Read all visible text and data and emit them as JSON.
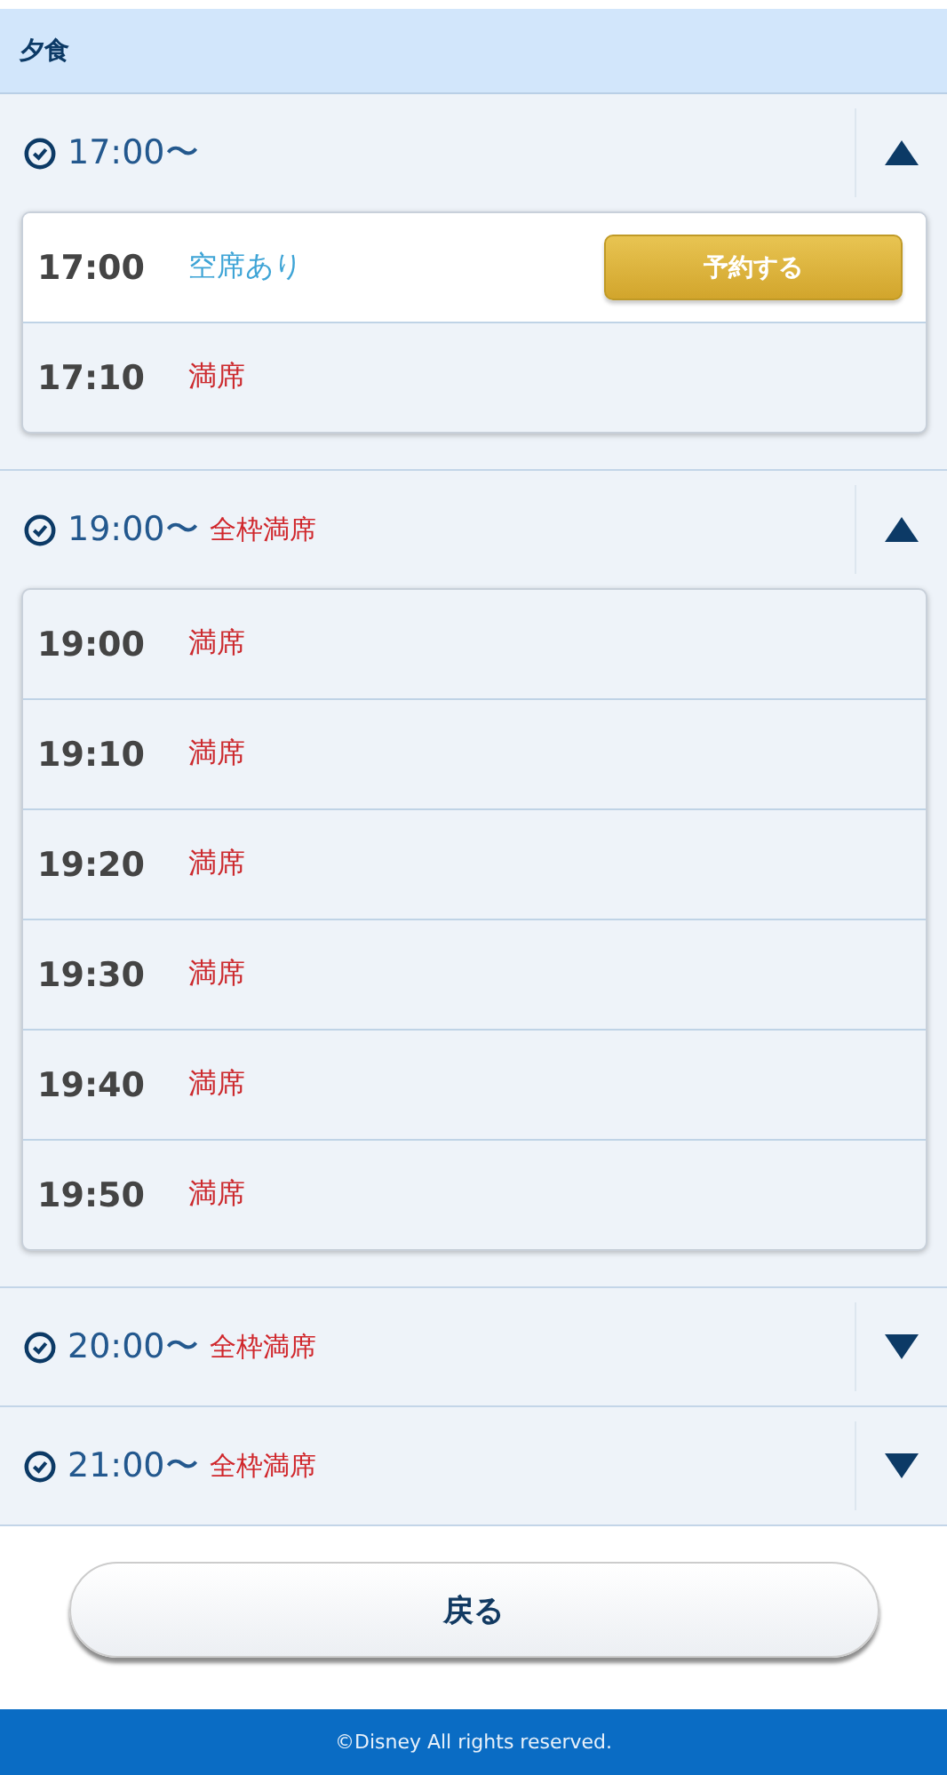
{
  "section_title": "夕食",
  "groups": [
    {
      "time": "17:00〜",
      "expanded": true,
      "slots": [
        {
          "time": "17:00",
          "status": "空席あり",
          "available": true,
          "button": "予約する"
        },
        {
          "time": "17:10",
          "status": "満席",
          "available": false
        }
      ]
    },
    {
      "time": "19:00〜",
      "status": "全枠満席",
      "expanded": true,
      "slots": [
        {
          "time": "19:00",
          "status": "満席",
          "available": false
        },
        {
          "time": "19:10",
          "status": "満席",
          "available": false
        },
        {
          "time": "19:20",
          "status": "満席",
          "available": false
        },
        {
          "time": "19:30",
          "status": "満席",
          "available": false
        },
        {
          "time": "19:40",
          "status": "満席",
          "available": false
        },
        {
          "time": "19:50",
          "status": "満席",
          "available": false
        }
      ]
    },
    {
      "time": "20:00〜",
      "status": "全枠満席",
      "expanded": false
    },
    {
      "time": "21:00〜",
      "status": "全枠満席",
      "expanded": false
    }
  ],
  "back_button": "戻る",
  "footer": "©Disney All rights reserved."
}
